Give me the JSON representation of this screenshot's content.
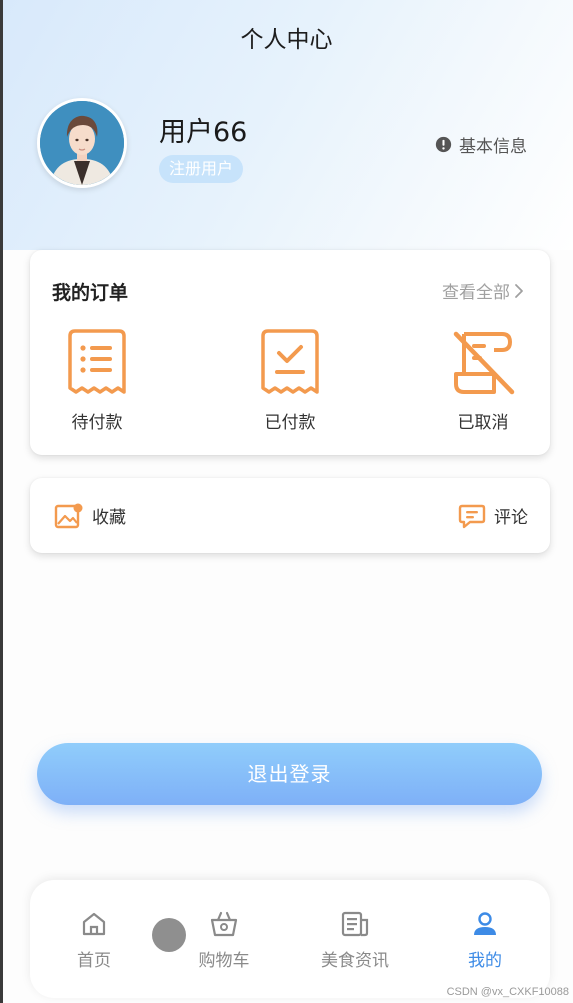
{
  "header": {
    "title": "个人中心"
  },
  "profile": {
    "username": "用户66",
    "role_badge": "注册用户",
    "basic_info_label": "基本信息"
  },
  "orders": {
    "title": "我的订单",
    "view_all_label": "查看全部",
    "items": [
      {
        "label": "待付款",
        "icon": "pending-payment-icon"
      },
      {
        "label": "已付款",
        "icon": "paid-icon"
      },
      {
        "label": "已取消",
        "icon": "cancelled-icon"
      }
    ]
  },
  "extras": {
    "favorites_label": "收藏",
    "comments_label": "评论"
  },
  "logout": {
    "label": "退出登录"
  },
  "tabbar": {
    "items": [
      {
        "label": "首页",
        "icon": "home-icon",
        "active": false
      },
      {
        "label": "购物车",
        "icon": "shopping-basket-icon",
        "active": false
      },
      {
        "label": "美食资讯",
        "icon": "news-icon",
        "active": false
      },
      {
        "label": "我的",
        "icon": "user-icon",
        "active": true
      }
    ]
  },
  "watermark": "CSDN @vx_CXKF10088",
  "colors": {
    "accent_orange": "#f39a4e",
    "accent_blue": "#3d8be6",
    "logout_gradient_top": "#90cdfb",
    "logout_gradient_bottom": "#7eb0f7",
    "badge_bg": "#c7e3fb"
  }
}
